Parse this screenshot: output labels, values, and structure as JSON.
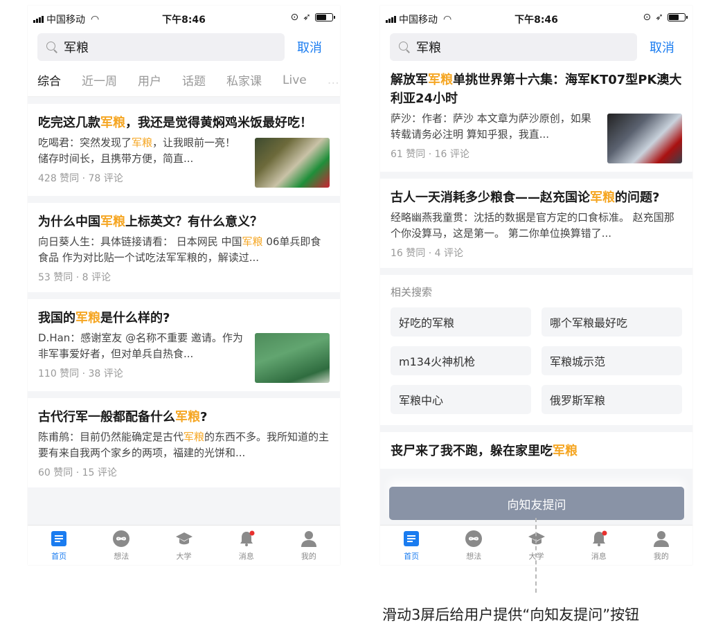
{
  "colors": {
    "accent": "#1a7cf0",
    "highlight": "#f5a623",
    "ask_button": "#8993a6"
  },
  "status_bar": {
    "carrier": "中国移动",
    "time": "下午8:46"
  },
  "search": {
    "query": "军粮",
    "cancel_label": "取消"
  },
  "tabs": [
    "综合",
    "近一周",
    "用户",
    "话题",
    "私家课",
    "Live",
    "…"
  ],
  "left_results": [
    {
      "title_pre": "吃完这几款",
      "title_hl": "军粮",
      "title_post": "，我还是觉得黄焖鸡米饭最好吃！",
      "excerpt_pre": "吃喝君：突然发现了",
      "excerpt_hl": "军粮",
      "excerpt_post": "，让我眼前一亮！储存时间长，且携带方便，简直...",
      "meta": "428 赞同 · 78 评论"
    },
    {
      "title_pre": "为什么中国",
      "title_hl": "军粮",
      "title_post": "上标英文？有什么意义？",
      "excerpt_pre": "向日葵人生：具体链接请看： 日本网民 中国",
      "excerpt_hl": "军粮",
      "excerpt_post": " 06单兵即食食品 作为对比贴一个试吃法军军粮的，解读过...",
      "meta": "53 赞同 · 8 评论"
    },
    {
      "title_pre": "我国的",
      "title_hl": "军粮",
      "title_post": "是什么样的?",
      "excerpt_pre": "D.Han：感谢室友 @名称不重要 邀请。作为非军事爱好者，但对单兵自热食...",
      "excerpt_hl": "",
      "excerpt_post": "",
      "meta": "110 赞同 · 38 评论"
    },
    {
      "title_pre": "古代行军一般都配备什么",
      "title_hl": "军粮",
      "title_post": "?",
      "excerpt_pre": "陈甫鸼：目前仍然能确定是古代",
      "excerpt_hl": "军粮",
      "excerpt_post": "的东西不多。我所知道的主要有来自我两个家乡的两项，福建的光饼和...",
      "meta": "60 赞同 · 15 评论"
    }
  ],
  "right_results": [
    {
      "title_pre": "解放军",
      "title_hl": "军粮",
      "title_post": "单挑世界第十六集：海军KT07型PK澳大利亚24小时",
      "excerpt_pre": "萨沙：作者：萨沙 本文章为萨沙原创，如果转载请务必注明 算知乎狠，我直...",
      "excerpt_hl": "",
      "excerpt_post": "",
      "meta": "61 赞同 · 16 评论"
    },
    {
      "title_pre": "古人一天消耗多少粮食——赵充国论",
      "title_hl": "军粮",
      "title_post": "的问题?",
      "excerpt_pre": "经略幽燕我童贯：沈括的数据是官方定的口食标准。 赵充国那个你没算马，这是第一。 第二你单位换算错了...",
      "excerpt_hl": "",
      "excerpt_post": "",
      "meta": "16 赞同 · 4 评论"
    }
  ],
  "related": {
    "title": "相关搜索",
    "items": [
      "好吃的军粮",
      "哪个军粮最好吃",
      "m134火神机枪",
      "军粮城示范",
      "军粮中心",
      "俄罗斯军粮"
    ]
  },
  "next_result": {
    "title_pre": "丧尸来了我不跑，躲在家里吃",
    "title_hl": "军粮"
  },
  "ask_button": "向知友提问",
  "tabbar": [
    {
      "label": "首页",
      "icon": "home-icon"
    },
    {
      "label": "想法",
      "icon": "infinity-icon"
    },
    {
      "label": "大学",
      "icon": "graduation-cap-icon"
    },
    {
      "label": "消息",
      "icon": "bell-icon"
    },
    {
      "label": "我的",
      "icon": "person-icon"
    }
  ],
  "caption": "滑动3屏后给用户提供“向知友提问”按钮"
}
